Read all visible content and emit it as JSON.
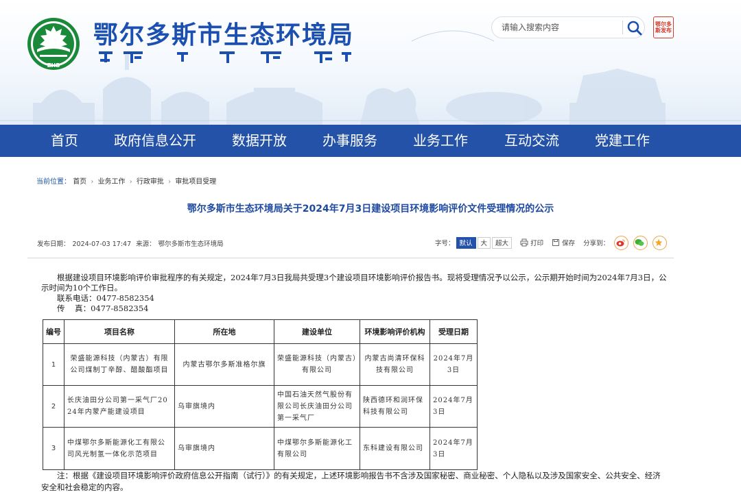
{
  "header": {
    "site_title": "鄂尔多斯市生态环境局",
    "logo_text": "ZHB",
    "search_placeholder": "请输入搜索内容",
    "seal_text": "鄂尔多斯发布"
  },
  "nav": {
    "items": [
      {
        "label": "首页"
      },
      {
        "label": "政府信息公开"
      },
      {
        "label": "数据开放"
      },
      {
        "label": "办事服务"
      },
      {
        "label": "业务工作"
      },
      {
        "label": "互动交流"
      },
      {
        "label": "党建工作"
      }
    ]
  },
  "breadcrumb": {
    "lead": "当前位置：",
    "items": [
      "首页",
      "业务工作",
      "行政审批",
      "审批项目受理"
    ],
    "separator": "›"
  },
  "article": {
    "title": "鄂尔多斯市生态环境局关于2024年7月3日建设项目环境影响评价文件受理情况的公示",
    "publish_label": "发布日期：",
    "publish_date": "2024-07-03 17:47",
    "source_label": "来源：",
    "source": "鄂尔多斯市生态环境局"
  },
  "tools": {
    "font_label": "字号：",
    "font_default": "默认",
    "font_large": "大",
    "font_xlarge": "超大",
    "print": "打印",
    "save": "保存",
    "share_label": "分享到："
  },
  "content": {
    "paragraph": "根据建设项目环境影响评价审批程序的有关规定，2024年7月3日我局共受理3个建设项目环境影响评价报告书。现将受理情况予以公示，公示期开始时间为2024年7月3日，公示时间为10个工作日。",
    "phone": "联系电话：0477-8582354",
    "fax": "传    真：0477-8582354",
    "note": "注：根据《建设项目环境影响评价政府信息公开指南（试行）》的有关规定，上述环境影响报告书不含涉及国家秘密、商业秘密、个人隐私以及涉及国家安全、公共安全、经济安全和社会稳定的内容。"
  },
  "table": {
    "headers": {
      "no": "编号",
      "name": "项目名称",
      "location": "所在地",
      "unit": "建设单位",
      "agency": "环境影响评价机构",
      "date": "受理日期"
    },
    "rows": [
      {
        "no": "1",
        "name": "荣盛能源科技（内蒙古）有限公司煤制丁辛醇、醋酸酯项目",
        "location": "内蒙古鄂尔多斯准格尔旗",
        "unit": "荣盛能源科技（内蒙古）有限公司",
        "agency": "内蒙古尚清环保科技有限公司",
        "date": "2024年7月3日"
      },
      {
        "no": "2",
        "name": "长庆油田分公司第一采气厂2024年内蒙产能建设项目",
        "location": "乌审旗境内",
        "unit": "中国石油天然气股份有限公司长庆油田分公司第一采气厂",
        "agency": "陕西德环和润环保科技有限公司",
        "date": "2024年7月3日"
      },
      {
        "no": "3",
        "name": "中煤鄂尔多斯能源化工有限公司风光制氢一体化示范项目",
        "location": "乌审旗境内",
        "unit": "中煤鄂尔多斯能源化工有限公司",
        "agency": "东科建设有限公司",
        "date": "2024年7月3日"
      }
    ]
  },
  "colors": {
    "primary": "#2452a8",
    "title_blue": "#1f4aa1",
    "seal_red": "#d23a2a",
    "logo_green": "#1a8a3a"
  }
}
